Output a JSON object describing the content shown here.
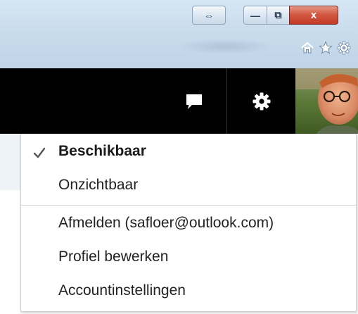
{
  "browser": {
    "window_buttons": {
      "snap_glyph": "⇔",
      "minimize_glyph": "—",
      "restore_glyph": "⧉",
      "close_glyph": "x"
    },
    "toolbar_icons": [
      "home-icon",
      "favorites-star-icon",
      "tools-gear-icon"
    ]
  },
  "app_header": {
    "buttons": [
      "chat-icon",
      "settings-gear-icon"
    ],
    "avatar": "profile-photo"
  },
  "status_menu": {
    "items": [
      {
        "label": "Beschikbaar",
        "selected": true
      },
      {
        "label": "Onzichtbaar",
        "selected": false
      },
      {
        "label": "Afmelden (safloer@outlook.com)",
        "selected": false
      },
      {
        "label": "Profiel bewerken",
        "selected": false
      },
      {
        "label": "Accountinstellingen",
        "selected": false
      }
    ]
  },
  "colors": {
    "header_background": "#000000",
    "close_button": "#c23a26",
    "menu_text": "#222222"
  }
}
